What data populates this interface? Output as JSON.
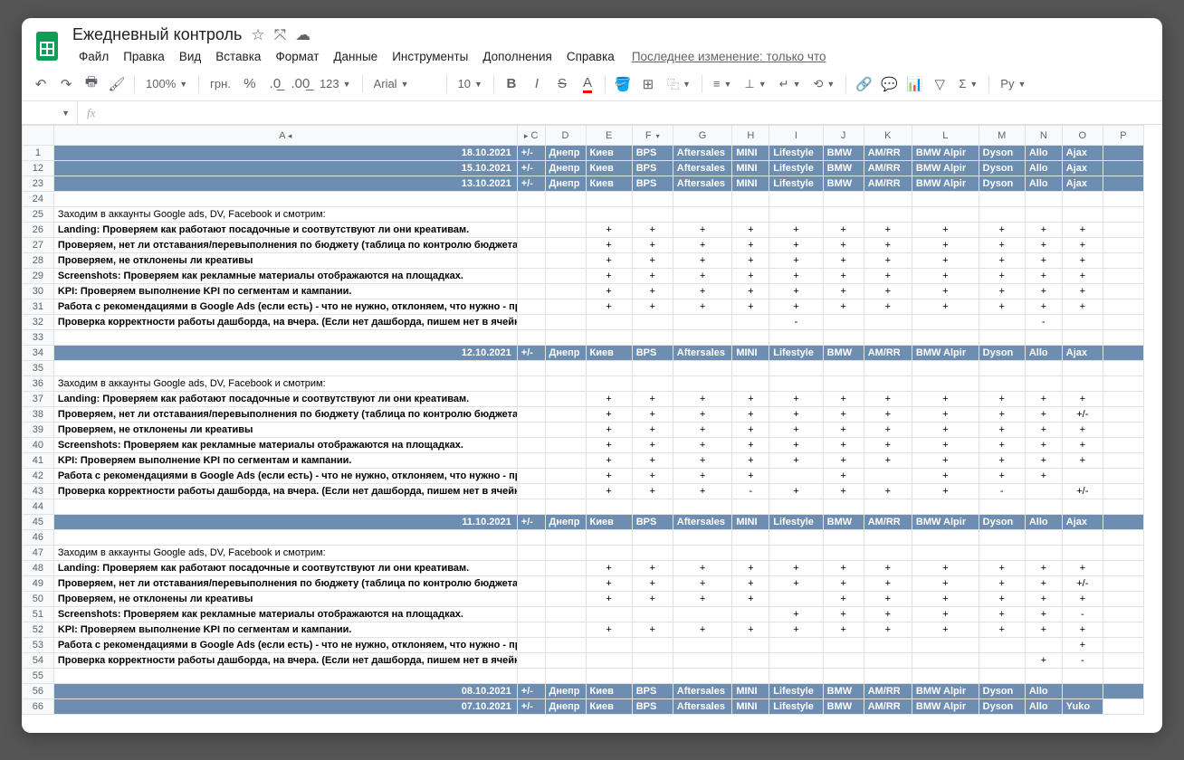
{
  "doc": {
    "title": "Ежедневный контроль"
  },
  "menus": [
    "Файл",
    "Правка",
    "Вид",
    "Вставка",
    "Формат",
    "Данные",
    "Инструменты",
    "Дополнения",
    "Справка"
  ],
  "last_edit": "Последнее изменение: только что",
  "toolbar": {
    "zoom": "100%",
    "currency": "грн.",
    "font": "Arial",
    "font_size": "10"
  },
  "fx": {
    "label": "fx"
  },
  "columns": [
    "A",
    "C",
    "D",
    "E",
    "F",
    "G",
    "H",
    "I",
    "J",
    "K",
    "L",
    "M",
    "N",
    "O",
    "P"
  ],
  "header_labels": [
    "+/-",
    "Днепр",
    "Киев",
    "",
    "BPS",
    "",
    "Aftersales",
    "MINI",
    "",
    "Lifestyle",
    "BMW",
    "",
    "AM/RR",
    "BMW Alpir",
    "Dyson",
    "Allo",
    "",
    "Ajax"
  ],
  "collapsed_header": [
    "+/-",
    "Днепр",
    "Киев",
    "BPS",
    "Aftersales",
    "MINI",
    "Lifestyle",
    "BMW",
    "AM/RR",
    "BMW Alpir",
    "Dyson",
    "Allo",
    "Ajax"
  ],
  "rows": [
    {
      "n": "1",
      "type": "header",
      "date": "18.10.2021",
      "labels": [
        "+/-",
        "Днепр",
        "Киев",
        "BPS",
        "Aftersales",
        "MINI",
        "Lifestyle",
        "BMW",
        "AM/RR",
        "BMW Alpir",
        "Dyson",
        "Allo",
        "Ajax"
      ]
    },
    {
      "n": "12",
      "type": "header",
      "date": "15.10.2021",
      "labels": [
        "+/-",
        "Днепр",
        "Киев",
        "BPS",
        "Aftersales",
        "MINI",
        "Lifestyle",
        "BMW",
        "AM/RR",
        "BMW Alpir",
        "Dyson",
        "Allo",
        "Ajax"
      ]
    },
    {
      "n": "23",
      "type": "header",
      "date": "13.10.2021",
      "labels": [
        "+/-",
        "Днепр",
        "Киев",
        "BPS",
        "Aftersales",
        "MINI",
        "Lifestyle",
        "BMW",
        "AM/RR",
        "BMW Alpir",
        "Dyson",
        "Allo",
        "Ajax"
      ]
    },
    {
      "n": "24",
      "type": "blank"
    },
    {
      "n": "25",
      "type": "text",
      "text": "Заходим в аккаунты Google ads, DV, Facebook и смотрим:"
    },
    {
      "n": "26",
      "type": "check",
      "text": "Landing: Проверяем как работают посадочные и соотвутствуют ли они креативам.",
      "vals": [
        "",
        "",
        "+",
        "+",
        "+",
        "+",
        "+",
        "+",
        "+",
        "+",
        "+",
        "+",
        "+"
      ]
    },
    {
      "n": "27",
      "type": "check",
      "text": "Проверяем, нет ли отставания/перевыполнения по бюджету (таблица по контролю бюджета, если есть)",
      "vals": [
        "",
        "",
        "+",
        "+",
        "+",
        "+",
        "+",
        "+",
        "+",
        "+",
        "+",
        "+",
        "+"
      ]
    },
    {
      "n": "28",
      "type": "check",
      "text": "Проверяем, не отклонены ли креативы",
      "vals": [
        "",
        "",
        "+",
        "+",
        "+",
        "+",
        "+",
        "+",
        "+",
        "+",
        "+",
        "+",
        "+"
      ]
    },
    {
      "n": "29",
      "type": "check",
      "text": "Screenshots: Проверяем как рекламные материалы отображаются на площадках.",
      "vals": [
        "",
        "",
        "+",
        "+",
        "+",
        "+",
        "+",
        "+",
        "+",
        "+",
        "+",
        "+",
        "+"
      ]
    },
    {
      "n": "30",
      "type": "check",
      "text": "KPI: Проверяем выполнение KPI по сегментам и кампании.",
      "vals": [
        "",
        "",
        "+",
        "+",
        "+",
        "+",
        "+",
        "+",
        "+",
        "+",
        "+",
        "+",
        "+"
      ]
    },
    {
      "n": "31",
      "type": "check",
      "text": "Работа с рекомендациями в Google Ads (если есть) - что не нужно, отклоняем, что нужно - применяем",
      "vals": [
        "",
        "",
        "+",
        "+",
        "+",
        "+",
        "+",
        "+",
        "+",
        "+",
        "+",
        "+",
        "+"
      ]
    },
    {
      "n": "32",
      "type": "check",
      "text": "Проверка корректности работы дашборда, на вчера. (Если нет дашборда, пишем нет в ячейке.)",
      "vals": [
        "",
        "",
        "",
        "",
        "",
        "",
        "-",
        "",
        "",
        "",
        "",
        "-",
        ""
      ]
    },
    {
      "n": "33",
      "type": "blank"
    },
    {
      "n": "34",
      "type": "header",
      "date": "12.10.2021",
      "labels": [
        "+/-",
        "Днепр",
        "Киев",
        "BPS",
        "Aftersales",
        "MINI",
        "Lifestyle",
        "BMW",
        "AM/RR",
        "BMW Alpir",
        "Dyson",
        "Allo",
        "Ajax"
      ]
    },
    {
      "n": "35",
      "type": "blank"
    },
    {
      "n": "36",
      "type": "text",
      "text": "Заходим в аккаунты Google ads, DV, Facebook и смотрим:"
    },
    {
      "n": "37",
      "type": "check",
      "text": "Landing: Проверяем как работают посадочные и соотвутствуют ли они креативам.",
      "vals": [
        "",
        "",
        "+",
        "+",
        "+",
        "+",
        "+",
        "+",
        "+",
        "+",
        "+",
        "+",
        "+"
      ]
    },
    {
      "n": "38",
      "type": "check",
      "text": "Проверяем, нет ли отставания/перевыполнения по бюджету (таблица по контролю бюджета, если есть)",
      "vals": [
        "",
        "",
        "+",
        "+",
        "+",
        "+",
        "+",
        "+",
        "+",
        "+",
        "+",
        "+",
        "+/-"
      ]
    },
    {
      "n": "39",
      "type": "check",
      "text": "Проверяем, не отклонены ли креативы",
      "vals": [
        "",
        "",
        "+",
        "+",
        "+",
        "+",
        "+",
        "+",
        "+",
        "+",
        "+",
        "+",
        "+"
      ]
    },
    {
      "n": "40",
      "type": "check",
      "text": "Screenshots: Проверяем как рекламные материалы отображаются на площадках.",
      "vals": [
        "",
        "",
        "+",
        "+",
        "+",
        "+",
        "+",
        "+",
        "+",
        "+",
        "+",
        "+",
        "+"
      ]
    },
    {
      "n": "41",
      "type": "check",
      "text": "KPI: Проверяем выполнение KPI по сегментам и кампании.",
      "vals": [
        "",
        "",
        "+",
        "+",
        "+",
        "+",
        "+",
        "+",
        "+",
        "+",
        "+",
        "+",
        "+"
      ]
    },
    {
      "n": "42",
      "type": "check",
      "text": "Работа с рекомендациями в Google Ads (если есть) - что не нужно, отклоняем, что нужно - применяем",
      "vals": [
        "",
        "",
        "+",
        "+",
        "+",
        "+",
        "",
        "+",
        "",
        "+",
        "+",
        "+",
        ""
      ]
    },
    {
      "n": "43",
      "type": "check",
      "text": "Проверка корректности работы дашборда, на вчера. (Если нет дашборда, пишем нет в ячейке.)",
      "vals": [
        "",
        "",
        "+",
        "+",
        "+",
        "-",
        "+",
        "+",
        "+",
        "+",
        "-",
        "",
        "+/-"
      ]
    },
    {
      "n": "44",
      "type": "blank"
    },
    {
      "n": "45",
      "type": "header",
      "date": "11.10.2021",
      "labels": [
        "+/-",
        "Днепр",
        "Киев",
        "BPS",
        "Aftersales",
        "MINI",
        "Lifestyle",
        "BMW",
        "AM/RR",
        "BMW Alpir",
        "Dyson",
        "Allo",
        "Ajax"
      ]
    },
    {
      "n": "46",
      "type": "blank"
    },
    {
      "n": "47",
      "type": "text",
      "text": "Заходим в аккаунты Google ads, DV, Facebook и смотрим:"
    },
    {
      "n": "48",
      "type": "check",
      "text": "Landing: Проверяем как работают посадочные и соотвутствуют ли они креативам.",
      "vals": [
        "",
        "",
        "+",
        "+",
        "+",
        "+",
        "+",
        "+",
        "+",
        "+",
        "+",
        "+",
        "+"
      ]
    },
    {
      "n": "49",
      "type": "check",
      "text": "Проверяем, нет ли отставания/перевыполнения по бюджету (таблица по контролю бюджета, если есть)",
      "vals": [
        "",
        "",
        "+",
        "+",
        "+",
        "+",
        "+",
        "+",
        "+",
        "+",
        "+",
        "+",
        "+/-"
      ]
    },
    {
      "n": "50",
      "type": "check",
      "text": "Проверяем, не отклонены ли креативы",
      "vals": [
        "",
        "",
        "+",
        "+",
        "+",
        "+",
        "",
        "+",
        "+",
        "+",
        "+",
        "+",
        "+"
      ]
    },
    {
      "n": "51",
      "type": "check",
      "text": "Screenshots: Проверяем как рекламные материалы отображаются на площадках.",
      "vals": [
        "",
        "",
        "",
        "",
        "",
        "",
        "+",
        "+",
        "+",
        "+",
        "+",
        "+",
        "-"
      ]
    },
    {
      "n": "52",
      "type": "check",
      "text": "KPI: Проверяем выполнение KPI по сегментам и кампании.",
      "vals": [
        "",
        "",
        "+",
        "+",
        "+",
        "+",
        "+",
        "+",
        "+",
        "+",
        "+",
        "+",
        "+"
      ]
    },
    {
      "n": "53",
      "type": "check",
      "text": "Работа с рекомендациями в Google Ads (если есть) - что не нужно, отклоняем, что нужно - применяем",
      "vals": [
        "",
        "",
        "",
        "",
        "",
        "",
        "",
        "",
        "",
        "",
        "",
        "",
        "+"
      ]
    },
    {
      "n": "54",
      "type": "check",
      "text": "Проверка корректности работы дашборда, на вчера. (Если нет дашборда, пишем нет в ячейке.)",
      "vals": [
        "",
        "",
        "",
        "",
        "",
        "",
        "",
        "",
        "",
        "",
        "",
        "+",
        "-"
      ]
    },
    {
      "n": "55",
      "type": "blank"
    },
    {
      "n": "56",
      "type": "header",
      "date": "08.10.2021",
      "labels": [
        "+/-",
        "Днепр",
        "Киев",
        "BPS",
        "Aftersales",
        "MINI",
        "Lifestyle",
        "BMW",
        "AM/RR",
        "BMW Alpir",
        "Dyson",
        "Allo",
        ""
      ]
    },
    {
      "n": "66",
      "type": "header",
      "date": "07.10.2021",
      "labels": [
        "+/-",
        "Днепр",
        "Киев",
        "BPS",
        "Aftersales",
        "MINI",
        "Lifestyle",
        "BMW",
        "AM/RR",
        "BMW Alpir",
        "Dyson",
        "Allo",
        "Yuko"
      ],
      "last_plain": true
    }
  ]
}
